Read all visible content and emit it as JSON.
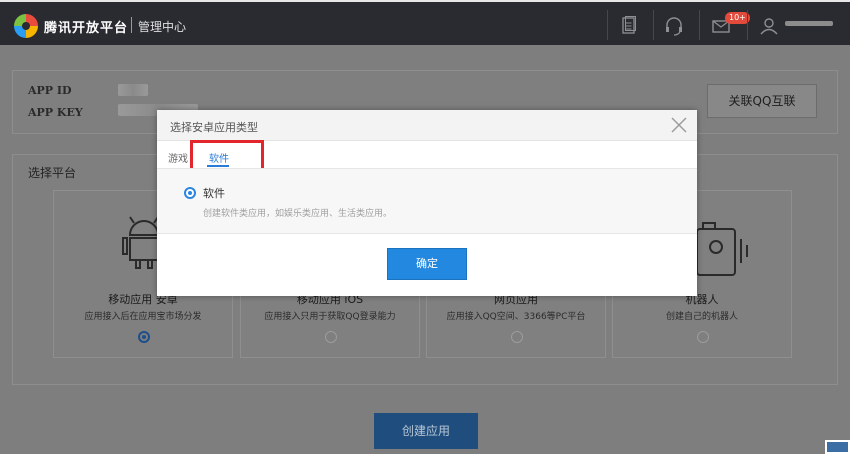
{
  "topbar": {
    "brand": "腾讯开放平台",
    "subtitle": "管理中心",
    "notification_badge": "10+",
    "icons": [
      "document-icon",
      "headset-icon",
      "mail-icon",
      "user-icon"
    ]
  },
  "app_info": {
    "app_id_label": "APP ID",
    "app_key_label": "APP KEY",
    "link_button": "关联QQ互联"
  },
  "platform": {
    "title": "选择平台",
    "cards": [
      {
        "title": "移动应用 安卓",
        "desc": "应用接入后在应用宝市场分发",
        "selected": true
      },
      {
        "title": "移动应用 iOS",
        "desc": "应用接入只用于获取QQ登录能力",
        "selected": false
      },
      {
        "title": "网页应用",
        "desc": "应用接入QQ空间、3366等PC平台",
        "selected": false
      },
      {
        "title": "机器人",
        "desc": "创建自己的机器人",
        "selected": false
      }
    ]
  },
  "create_button": "创建应用",
  "modal": {
    "title": "选择安卓应用类型",
    "tabs": [
      "游戏",
      "软件"
    ],
    "active_tab": "软件",
    "option_label": "软件",
    "option_desc": "创建软件类应用，如娱乐类应用、生活类应用。",
    "ok_button": "确定"
  },
  "colors": {
    "accent": "#2389e0",
    "highlight": "#e3262b",
    "topbar": "#292b30"
  }
}
